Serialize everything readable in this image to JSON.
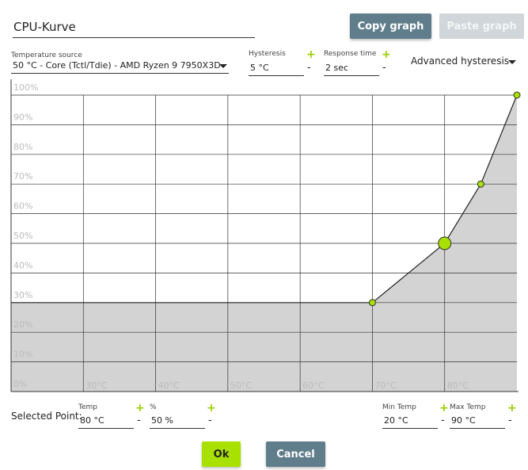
{
  "header": {
    "title_value": "CPU-Kurve",
    "copy_label": "Copy graph",
    "paste_label": "Paste graph"
  },
  "controls": {
    "temp_source_label": "Temperature source",
    "temp_source_value": "50 °C - Core (Tctl/Tdie) - AMD Ryzen 9 7950X3D",
    "hysteresis_label": "Hysteresis",
    "hysteresis_value": "5 °C",
    "response_label": "Response time",
    "response_value": "2 sec",
    "advanced_label": "Advanced hysteresis",
    "plus": "+",
    "minus": "-"
  },
  "selected": {
    "label": "Selected Point:",
    "temp_label": "Temp",
    "temp_value": "80 °C",
    "percent_label": "%",
    "percent_value": "50 %",
    "min_temp_label": "Min Temp",
    "min_temp_value": "20 °C",
    "max_temp_label": "Max Temp",
    "max_temp_value": "90 °C"
  },
  "footer": {
    "ok_label": "Ok",
    "cancel_label": "Cancel"
  },
  "colors": {
    "accent": "#a8e000",
    "button_slate": "#607d8b",
    "plus_green": "#9acc00",
    "fill_gray": "#d3d3d3"
  },
  "chart_data": {
    "type": "area",
    "y_ticks": [
      "0%",
      "10%",
      "20%",
      "30%",
      "40%",
      "50%",
      "60%",
      "70%",
      "80%",
      "90%",
      "100%"
    ],
    "x_ticks": [
      {
        "value": 30,
        "label": "30°C"
      },
      {
        "value": 40,
        "label": "40°C"
      },
      {
        "value": 50,
        "label": "50°C"
      },
      {
        "value": 60,
        "label": "60°C"
      },
      {
        "value": 70,
        "label": "70°C"
      },
      {
        "value": 80,
        "label": "80°C"
      }
    ],
    "xlim": [
      20,
      90
    ],
    "ylim": [
      0,
      100
    ],
    "grid": true,
    "points": [
      {
        "x": 20,
        "y": 30,
        "visible": false
      },
      {
        "x": 70,
        "y": 30,
        "visible": true
      },
      {
        "x": 80,
        "y": 50,
        "visible": true,
        "selected": true
      },
      {
        "x": 85,
        "y": 70,
        "visible": true
      },
      {
        "x": 90,
        "y": 100,
        "visible": true
      }
    ]
  }
}
